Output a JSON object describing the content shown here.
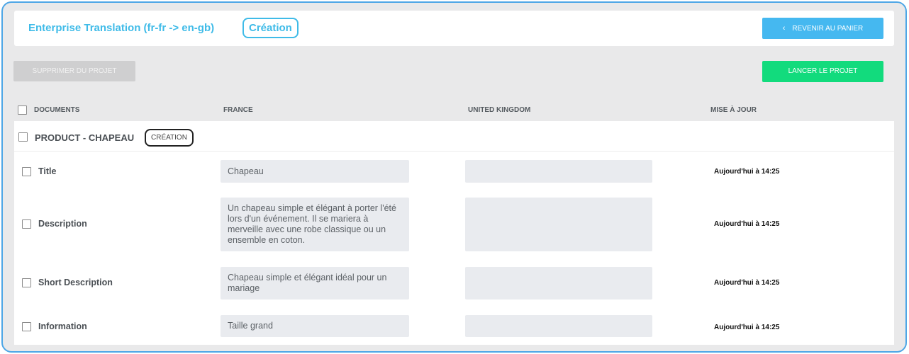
{
  "header": {
    "project_title": "Enterprise Translation (fr-fr -> en-gb)",
    "status": "Création",
    "back_label": "REVENIR AU PANIER",
    "back_icon": "chevron-left-icon"
  },
  "actions": {
    "delete_label": "SUPPRIMER DU PROJET",
    "launch_label": "LANCER LE PROJET"
  },
  "columns": {
    "documents": "DOCUMENTS",
    "source": "FRANCE",
    "target": "UNITED KINGDOM",
    "updated": "MISE À JOUR"
  },
  "group": {
    "title": "PRODUCT - CHAPEAU",
    "status": "CRÉATION"
  },
  "rows": [
    {
      "field": "Title",
      "source": "Chapeau",
      "target": "",
      "updated": "Aujourd'hui à 14:25"
    },
    {
      "field": "Description",
      "source": "Un chapeau simple et élégant à porter l'été lors d'un événement. Il se mariera à merveille avec une robe classique ou un ensemble en coton.",
      "target": "",
      "updated": "Aujourd'hui à 14:25"
    },
    {
      "field": "Short Description",
      "source": "Chapeau simple et élégant idéal pour un mariage",
      "target": "",
      "updated": "Aujourd'hui à 14:25"
    },
    {
      "field": "Information",
      "source": "Taille grand",
      "target": "",
      "updated": "Aujourd'hui à 14:25"
    }
  ],
  "colors": {
    "accent": "#3fbbe8",
    "back_button": "#45b8f0",
    "launch_button": "#12db7d",
    "disabled_button": "#cfcfd0",
    "frame_border": "#4da6e6"
  }
}
